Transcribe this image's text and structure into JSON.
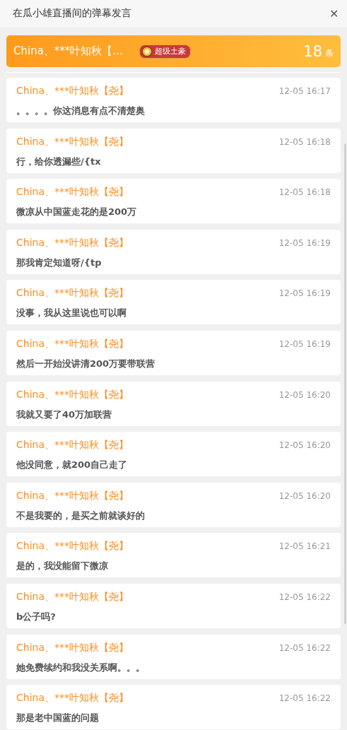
{
  "window": {
    "title": "在瓜小雄直播间的弹幕发言",
    "close": "✕"
  },
  "summary": {
    "name": "China、***叶知秋【...",
    "badge": "超级土豪",
    "count": "18",
    "unit": "条"
  },
  "messages": [
    {
      "name": "China、***叶知秋【尧】",
      "time": "12-05 16:17",
      "text": "。。。。你这消息有点不清楚奥"
    },
    {
      "name": "China、***叶知秋【尧】",
      "time": "12-05 16:18",
      "text": "行，给你透漏些/{tx"
    },
    {
      "name": "China、***叶知秋【尧】",
      "time": "12-05 16:18",
      "text": "微凉从中国蓝走花的是200万"
    },
    {
      "name": "China、***叶知秋【尧】",
      "time": "12-05 16:19",
      "text": "那我肯定知道呀/{tp"
    },
    {
      "name": "China、***叶知秋【尧】",
      "time": "12-05 16:19",
      "text": "没事，我从这里说也可以啊"
    },
    {
      "name": "China、***叶知秋【尧】",
      "time": "12-05 16:19",
      "text": "然后一开始没讲清200万要带联营"
    },
    {
      "name": "China、***叶知秋【尧】",
      "time": "12-05 16:20",
      "text": "我就又要了40万加联营"
    },
    {
      "name": "China、***叶知秋【尧】",
      "time": "12-05 16:20",
      "text": "他没同意，就200自己走了"
    },
    {
      "name": "China、***叶知秋【尧】",
      "time": "12-05 16:20",
      "text": "不是我要的，是买之前就谈好的"
    },
    {
      "name": "China、***叶知秋【尧】",
      "time": "12-05 16:21",
      "text": "是的，我没能留下微凉"
    },
    {
      "name": "China、***叶知秋【尧】",
      "time": "12-05 16:22",
      "text": "b公子吗?"
    },
    {
      "name": "China、***叶知秋【尧】",
      "time": "12-05 16:22",
      "text": "她免费续约和我没关系啊。。。"
    },
    {
      "name": "China、***叶知秋【尧】",
      "time": "12-05 16:22",
      "text": "那是老中国蓝的问题"
    }
  ]
}
